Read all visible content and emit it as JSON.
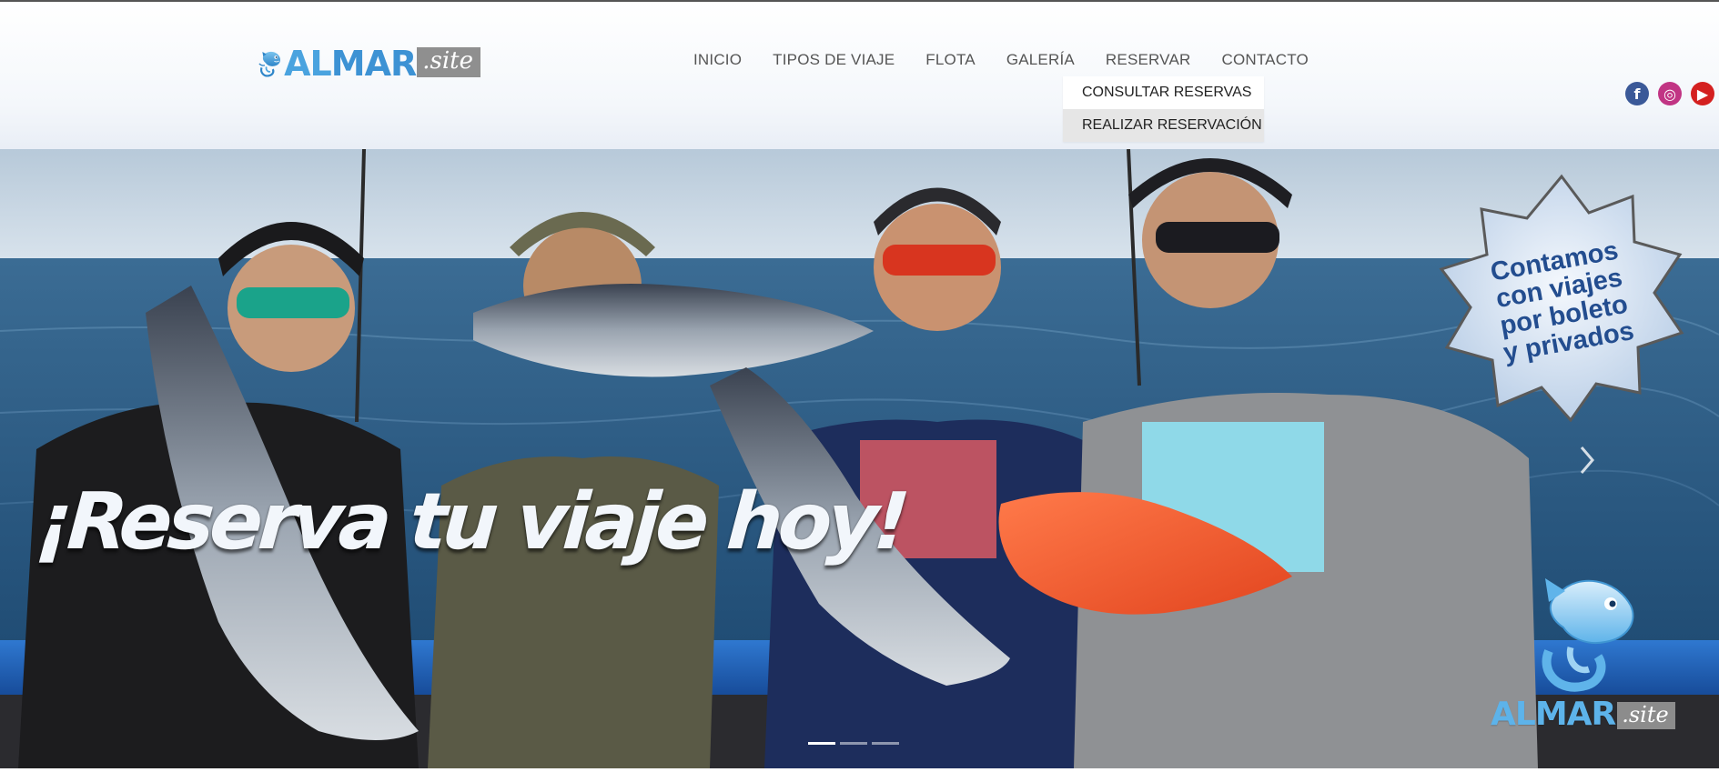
{
  "brand": {
    "logo_main_light": "AL",
    "logo_main_dark": "MAR",
    "logo_suffix": ".site",
    "logo_icon": "fish-icon",
    "primary_color": "#3d92d4",
    "suffix_bg_color": "#8f8f8f"
  },
  "nav": {
    "items": [
      {
        "label": "INICIO"
      },
      {
        "label": "TIPOS DE VIAJE"
      },
      {
        "label": "FLOTA"
      },
      {
        "label": "GALERÍA"
      },
      {
        "label": "RESERVAR"
      },
      {
        "label": "CONTACTO"
      }
    ],
    "text_color": "#555555"
  },
  "dropdown": {
    "parent": "RESERVAR",
    "items": [
      {
        "label": "CONSULTAR RESERVAS",
        "highlighted": false
      },
      {
        "label": "REALIZAR RESERVACIÓN",
        "highlighted": true
      }
    ],
    "highlight_color": "#e6e6e6"
  },
  "social": [
    {
      "icon": "facebook-icon",
      "glyph": "f",
      "color": "#3b5998"
    },
    {
      "icon": "instagram-icon",
      "glyph": "◎",
      "color": "#c13584"
    },
    {
      "icon": "youtube-icon",
      "glyph": "▶",
      "color": "#d42020"
    }
  ],
  "hero": {
    "headline": "¡Reserva tu viaje hoy!",
    "badge_lines": [
      "Contamos",
      "con viajes",
      "por boleto",
      "y privados"
    ],
    "watermark_main_light": "AL",
    "watermark_main_dark": "MAR",
    "watermark_suffix": ".site",
    "slide_count": 3,
    "active_slide": 1,
    "next_icon": "chevron-right-icon",
    "sea_color": "#2a5a82",
    "sky_color": "#c9d8e6",
    "boat_rail_color": "#1f5fb5"
  }
}
